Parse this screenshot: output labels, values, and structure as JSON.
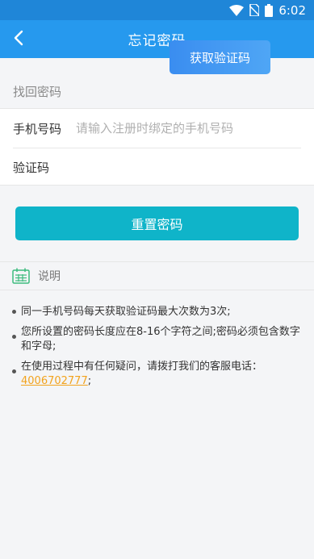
{
  "status_bar": {
    "time": "6:02",
    "icons": [
      "wifi-icon",
      "no-sim-icon",
      "battery-icon"
    ]
  },
  "header": {
    "title": "忘记密码",
    "back_icon": "chevron-left-icon"
  },
  "section": {
    "label": "找回密码"
  },
  "form": {
    "phone_label": "手机号码",
    "phone_placeholder": "请输入注册时绑定的手机号码",
    "phone_value": "",
    "code_label": "验证码",
    "code_value": "",
    "get_code_label": "获取验证码"
  },
  "reset_button": {
    "label": "重置密码"
  },
  "notes": {
    "title": "说明",
    "icon": "calendar-list-icon",
    "item1": "同一手机号码每天获取验证码最大次数为3次;",
    "item2": "您所设置的密码长度应在8-16个字符之间;密码必须包含数字和字母;",
    "item3_prefix": "在使用过程中有任何疑问，请拨打我们的客服电话：",
    "item3_phone": "4006702777",
    "item3_suffix": ";"
  },
  "colors": {
    "status_bar": "#1f86d8",
    "app_bar": "#2699ee",
    "get_code_button": "#3a8df0",
    "reset_button": "#0fb4c9",
    "phone_link": "#f2a31e",
    "notes_icon": "#3dbb7e"
  }
}
